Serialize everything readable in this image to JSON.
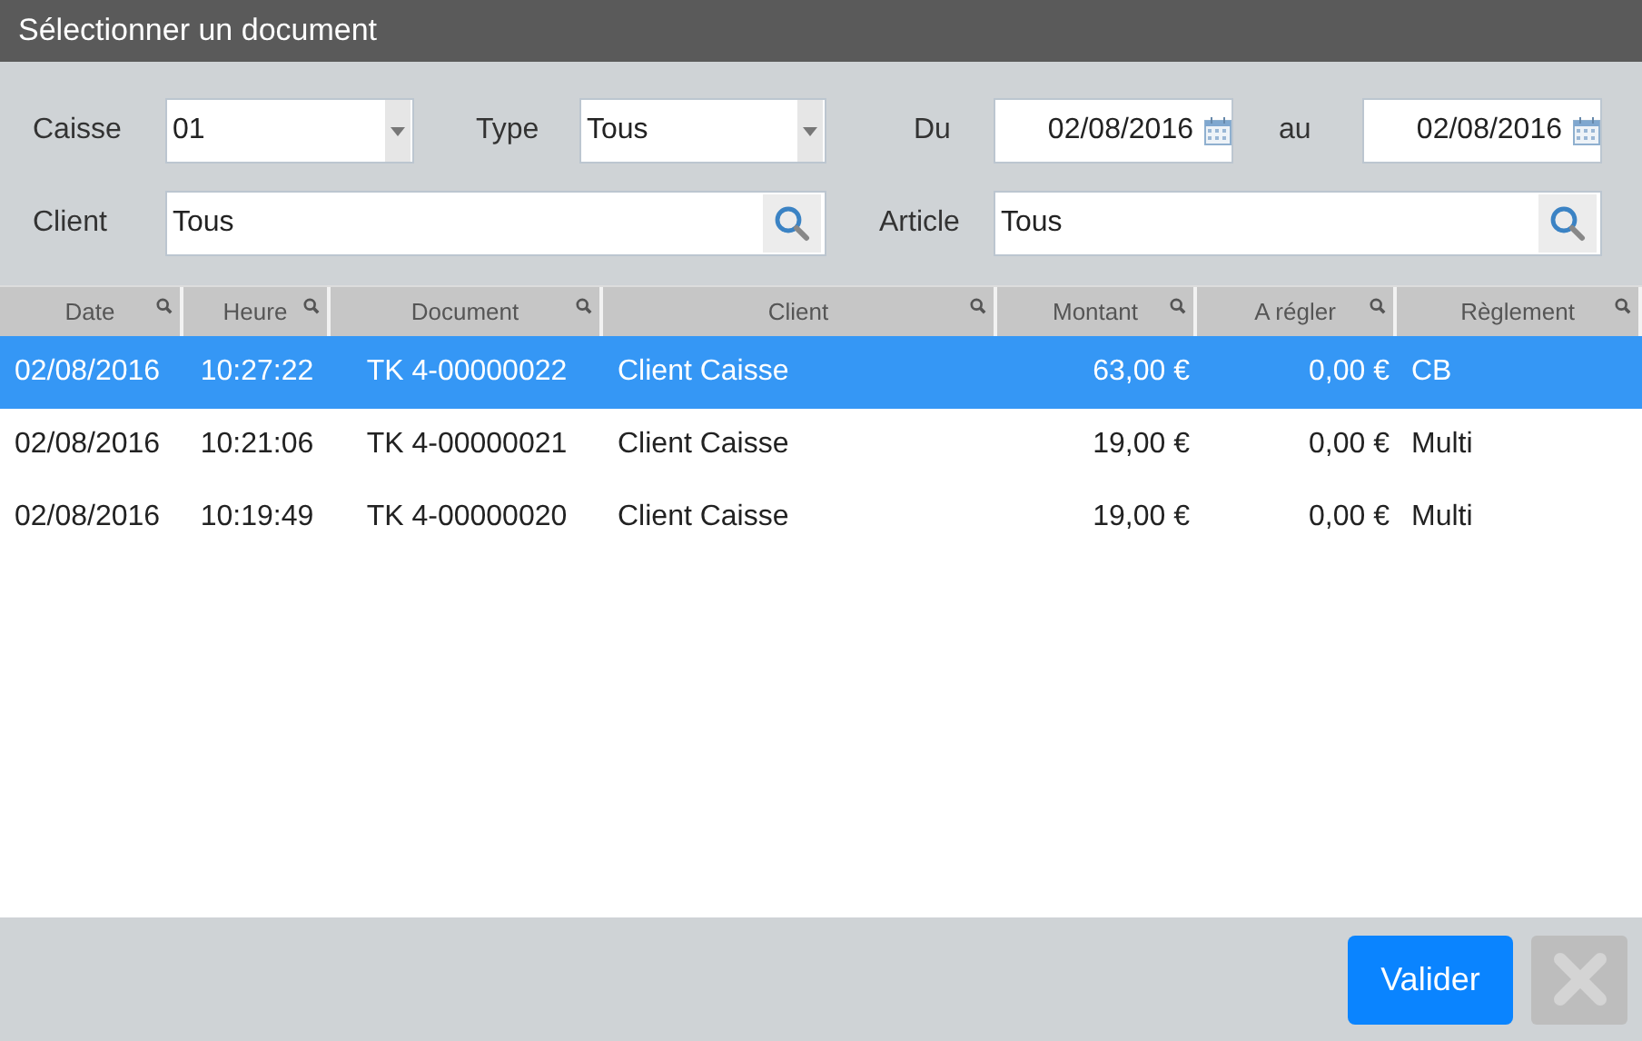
{
  "window": {
    "title": "Sélectionner un document"
  },
  "filters": {
    "caisse": {
      "label": "Caisse",
      "value": "01"
    },
    "type": {
      "label": "Type",
      "value": "Tous"
    },
    "du": {
      "label": "Du",
      "value": "02/08/2016"
    },
    "au": {
      "label": "au",
      "value": "02/08/2016"
    },
    "client": {
      "label": "Client",
      "value": "Tous"
    },
    "article": {
      "label": "Article",
      "value": "Tous"
    }
  },
  "table": {
    "columns": [
      "Date",
      "Heure",
      "Document",
      "Client",
      "Montant",
      "A régler",
      "Règlement"
    ],
    "rows": [
      {
        "selected": true,
        "cells": [
          "02/08/2016",
          "10:27:22",
          "TK 4-00000022",
          "Client Caisse",
          "63,00 €",
          "0,00 €",
          "CB"
        ]
      },
      {
        "selected": false,
        "cells": [
          "02/08/2016",
          "10:21:06",
          "TK 4-00000021",
          "Client Caisse",
          "19,00 €",
          "0,00 €",
          "Multi"
        ]
      },
      {
        "selected": false,
        "cells": [
          "02/08/2016",
          "10:19:49",
          "TK 4-00000020",
          "Client Caisse",
          "19,00 €",
          "0,00 €",
          "Multi"
        ]
      }
    ]
  },
  "buttons": {
    "validate": {
      "label": "Valider"
    },
    "close": {
      "disabled": true
    }
  }
}
